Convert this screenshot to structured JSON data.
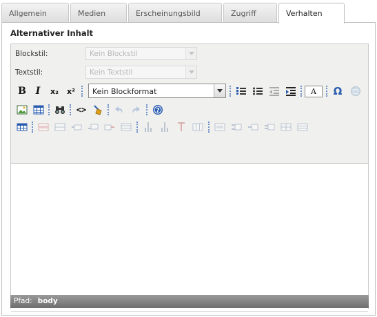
{
  "tabs": [
    {
      "label": "Allgemein",
      "active": false
    },
    {
      "label": "Medien",
      "active": false
    },
    {
      "label": "Erscheinungsbild",
      "active": false
    },
    {
      "label": "Zugriff",
      "active": false
    },
    {
      "label": "Verhalten",
      "active": true
    }
  ],
  "section": {
    "title": "Alternativer Inhalt"
  },
  "editor": {
    "blockstyle": {
      "label": "Blockstil:",
      "value": "Kein Blockstil"
    },
    "textstyle": {
      "label": "Textstil:",
      "value": "Kein Textstil"
    },
    "format_select": {
      "value": "Kein Blockformat"
    },
    "toolbar1": {
      "bold": "B",
      "italic": "I",
      "subscript": "x₂",
      "superscript": "x²",
      "text_color": "A",
      "special_char": "Ω"
    },
    "toolbar2": {
      "source": "<>"
    }
  },
  "statusbar": {
    "path_label": "Pfad:",
    "path_value": "body"
  },
  "colors": {
    "separator": "#6f8fc8",
    "statusbar": "#7a7a7a",
    "icon_blue": "#2a5db0"
  }
}
